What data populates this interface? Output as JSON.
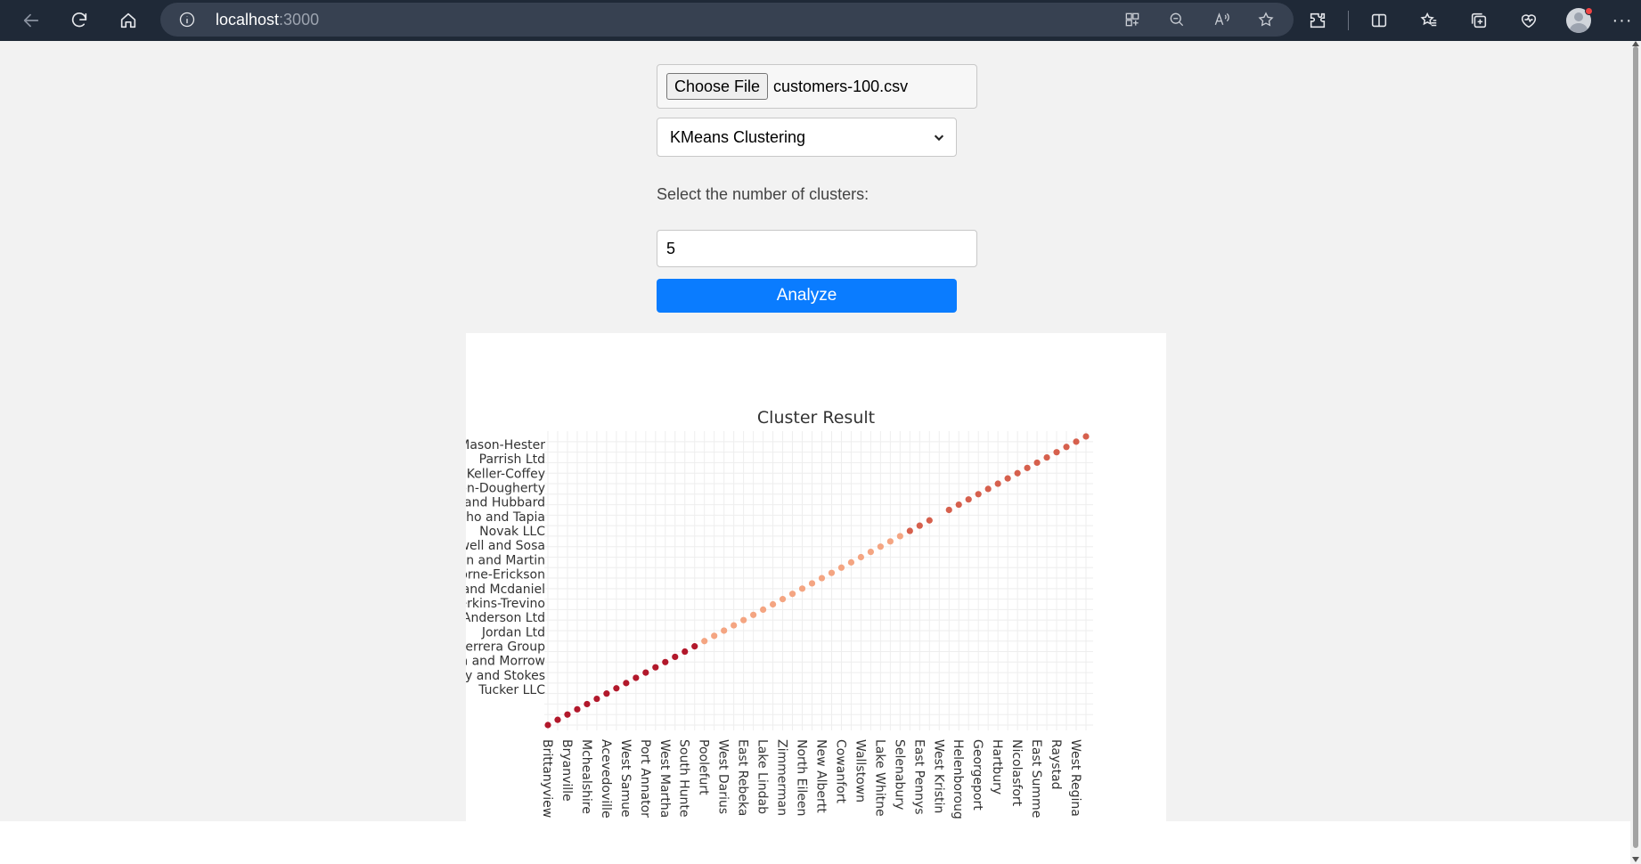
{
  "browser": {
    "url_host": "localhost",
    "url_port": ":3000"
  },
  "icons": {
    "back": "back-arrow-icon",
    "refresh": "refresh-icon",
    "home": "home-icon",
    "info": "info-icon",
    "apps": "apps-icon",
    "zoom": "zoom-out-icon",
    "read_aloud": "read-aloud-icon",
    "favorite": "star-icon",
    "extensions": "puzzle-icon",
    "split": "split-screen-icon",
    "favorites": "favorites-icon",
    "collections": "collections-icon",
    "health": "browser-essentials-icon",
    "more": "more-icon"
  },
  "form": {
    "file_button_label": "Choose File",
    "file_name": "customers-100.csv",
    "algorithm_selected": "KMeans Clustering",
    "clusters_label": "Select the number of clusters:",
    "clusters_value": "5",
    "analyze_label": "Analyze"
  },
  "chart_data": {
    "type": "scatter",
    "title": "Cluster Result",
    "y_tick_labels": [
      "Tucker LLC",
      "y and Stokes",
      "n and Morrow",
      "Herrera Group",
      "Jordan Ltd",
      "Anderson Ltd",
      "erkins-Trevino",
      "and Mcdaniel",
      "orne-Erickson",
      "in and Martin",
      "well and Sosa",
      "Novak LLC",
      "cho and Tapia",
      "and Hubbard",
      "on-Dougherty",
      "Keller-Coffey",
      "Parrish Ltd",
      "Mason-Hester"
    ],
    "x_tick_labels": [
      "Brittanyview",
      "Bryanville",
      "Mchealshire",
      "Acevedoville",
      "West Samue",
      "Port Annator",
      "West Martha",
      "South Hunte",
      "Poolefurt",
      "West Darius",
      "East Rebeka",
      "Lake Lindab",
      "Zimmerman",
      "North Eileen",
      "New Albertt",
      "Cowanfort",
      "Wallstown",
      "Lake Whitne",
      "Selenabury",
      "East Pennys",
      "West Kristin",
      "Helenboroug",
      "Georgeport",
      "Hartbury",
      "Nicolasfort",
      "East Summe",
      "Raystad",
      "West Regina"
    ],
    "point_count": 56,
    "clusters": [
      {
        "range": [
          0,
          15
        ],
        "color": "#b2182b"
      },
      {
        "range": [
          16,
          36
        ],
        "color": "#f4a582"
      },
      {
        "range": [
          37,
          55
        ],
        "color": "#d6604d"
      }
    ],
    "missing_points": [
      40
    ],
    "grid": true
  }
}
